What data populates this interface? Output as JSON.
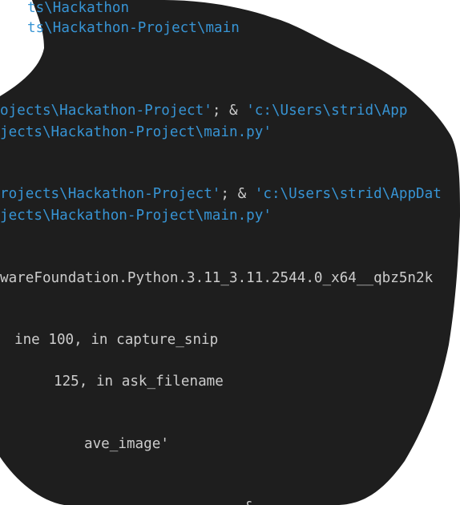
{
  "colors": {
    "background": "#ffffff",
    "terminal_bg": "#1e1e1e",
    "path_text": "#3794d4",
    "plain_text": "#cccccc",
    "string_text": "#c8ced6"
  },
  "terminal": {
    "lines": [
      {
        "segments": [
          {
            "text": "ts\\Hackathon",
            "color": "#3794d4"
          }
        ]
      },
      {
        "segments": [
          {
            "text": "ts\\Hackathon-Project\\main",
            "color": "#3794d4"
          }
        ]
      },
      {
        "segments": [
          {
            "text": "ojects\\Hackathon-Project'",
            "color": "#3794d4"
          },
          {
            "text": "; & ",
            "color": "#cccccc"
          },
          {
            "text": "'c:\\Users\\strid\\App",
            "color": "#3794d4"
          }
        ]
      },
      {
        "segments": [
          {
            "text": "jects\\Hackathon-Project\\main.py'",
            "color": "#3794d4"
          }
        ]
      },
      {
        "segments": [
          {
            "text": "rojects\\Hackathon-Project'",
            "color": "#3794d4"
          },
          {
            "text": "; & ",
            "color": "#cccccc"
          },
          {
            "text": "'c:\\Users\\strid\\AppDat",
            "color": "#3794d4"
          }
        ]
      },
      {
        "segments": [
          {
            "text": "jects\\Hackathon-Project\\main.py'",
            "color": "#3794d4"
          }
        ]
      },
      {
        "segments": [
          {
            "text": "wareFoundation.Python.3.11_3.11.2544.0_x64__qbz5n2k",
            "color": "#cccccc"
          }
        ]
      },
      {
        "segments": [
          {
            "text": "ine 100, in capture_snip",
            "color": "#cccccc"
          }
        ]
      },
      {
        "segments": [
          {
            "text": "125, in ask_filename",
            "color": "#cccccc"
          }
        ]
      },
      {
        "segments": [
          {
            "text": "ave_image'",
            "color": "#cccccc"
          }
        ]
      },
      {
        "segments": [
          {
            "text": "& ",
            "color": "#cccccc"
          }
        ]
      }
    ]
  }
}
